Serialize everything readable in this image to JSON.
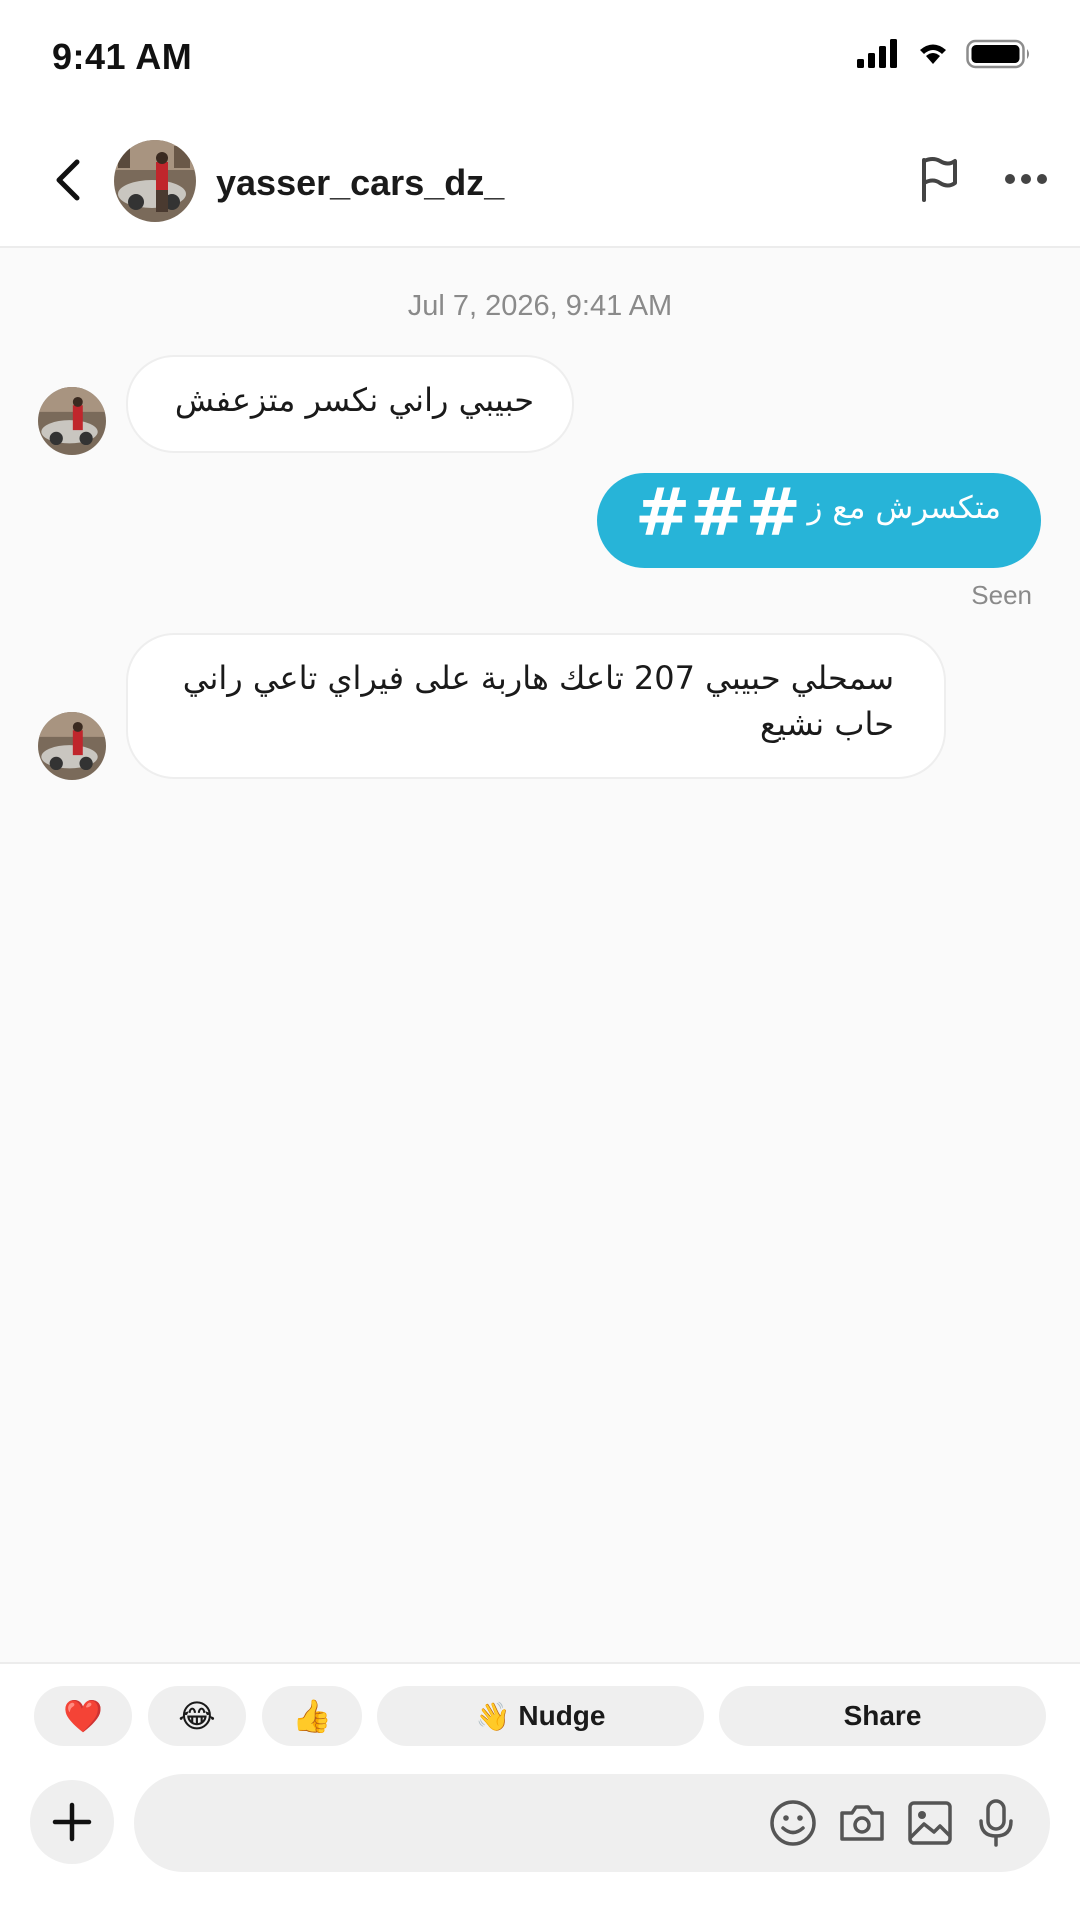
{
  "status_bar": {
    "time": "9:41  AM",
    "icons": [
      "signal-icon",
      "wifi-icon",
      "battery-icon"
    ]
  },
  "header": {
    "username": "yasser_cars_dz_",
    "icons": [
      "back-icon",
      "flag-icon",
      "more-icon"
    ]
  },
  "conversation": {
    "timestamp": "Jul 7, 2026, 9:41 AM",
    "messages": [
      {
        "direction": "incoming",
        "text": "حبيبي راني نكسر متزعفش"
      },
      {
        "direction": "outgoing",
        "text": "متكسرش مع ز",
        "overlay": "###",
        "status": "Seen"
      },
      {
        "direction": "incoming",
        "text": "سمحلي حبيبي 207 تاعك هاربة على فيراي تاعي راني حاب نشيع"
      }
    ]
  },
  "quick_replies": {
    "reactions": [
      "❤️",
      "😂",
      "👍"
    ],
    "nudge_emoji": "👋",
    "nudge_label": "Nudge",
    "share_label": "Share"
  },
  "composer": {
    "placeholder": "",
    "icons": [
      "plus-icon",
      "emoji-icon",
      "camera-icon",
      "image-icon",
      "microphone-icon"
    ]
  },
  "colors": {
    "outgoing_bubble": "#27b4d8",
    "background": "#fafafa",
    "chip_background": "#efefef"
  }
}
